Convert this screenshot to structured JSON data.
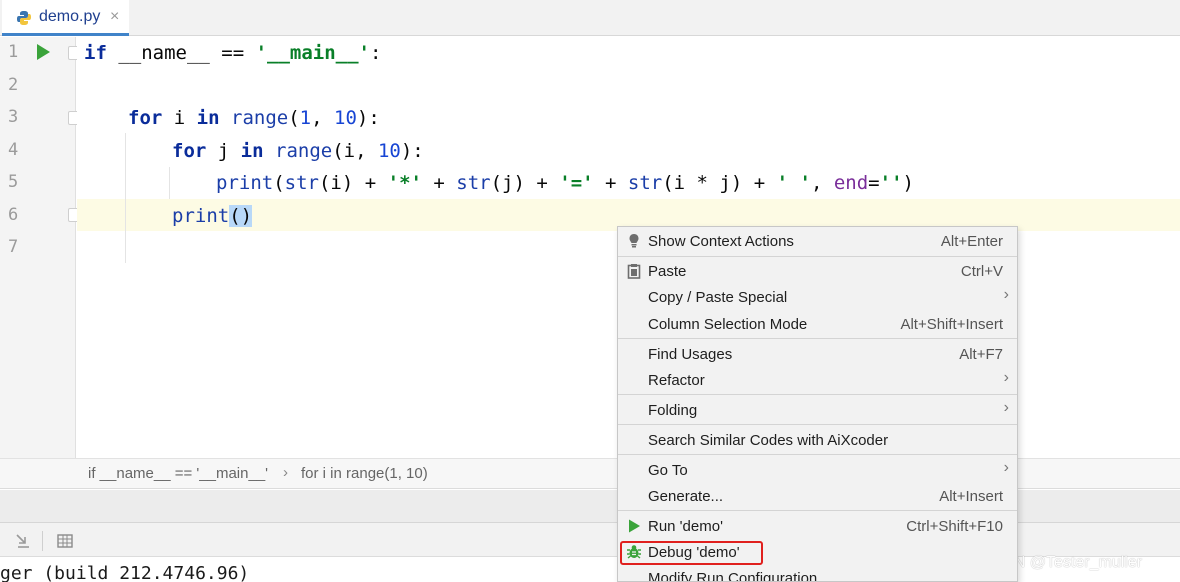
{
  "tab": {
    "filename": "demo.py",
    "close": "×"
  },
  "gutter": {
    "line_numbers": [
      "1",
      "2",
      "3",
      "4",
      "5",
      "6",
      "7"
    ]
  },
  "code": {
    "line1": {
      "kw": "if",
      "a": " __name__ == ",
      "s": "'__main__'",
      "b": ":"
    },
    "line3": {
      "kw1": "for",
      "a": " i ",
      "kw2": "in",
      "b": " ",
      "fn": "range",
      "c": "(",
      "n1": "1",
      "d": ", ",
      "n2": "10",
      "e": "):"
    },
    "line4": {
      "kw1": "for",
      "a": " j ",
      "kw2": "in",
      "b": " ",
      "fn": "range",
      "c": "(i, ",
      "n1": "10",
      "d": "):"
    },
    "line5": {
      "fn1": "print",
      "a": "(",
      "fn2": "str",
      "b": "(i) + ",
      "s1": "'*'",
      "c": " + ",
      "fn3": "str",
      "d": "(j) + ",
      "s2": "'='",
      "e": " + ",
      "fn4": "str",
      "f": "(i * j) + ",
      "s3": "' '",
      "g": ", ",
      "p": "end",
      "h": "=",
      "s4": "''",
      "i": ")"
    },
    "line6": {
      "fn": "print",
      "br": "()"
    }
  },
  "breadcrumb": {
    "item1": "if __name__ == '__main__'",
    "sep": "›",
    "item2": "for i in range(1, 10)"
  },
  "console": {
    "text": "ger (build 212.4746.96)"
  },
  "watermark": "CSDN @Tester_muller",
  "context_menu": {
    "show_context_actions": {
      "label": "Show Context Actions",
      "shortcut": "Alt+Enter"
    },
    "paste": {
      "label": "Paste",
      "shortcut": "Ctrl+V"
    },
    "copy_paste_special": {
      "label": "Copy / Paste Special"
    },
    "column_selection_mode": {
      "label": "Column Selection Mode",
      "shortcut": "Alt+Shift+Insert"
    },
    "find_usages": {
      "label": "Find Usages",
      "shortcut": "Alt+F7"
    },
    "refactor": {
      "label": "Refactor"
    },
    "folding": {
      "label": "Folding"
    },
    "search_similar": {
      "label": "Search Similar Codes with AiXcoder"
    },
    "go_to": {
      "label": "Go To"
    },
    "generate": {
      "label": "Generate...",
      "shortcut": "Alt+Insert"
    },
    "run": {
      "label": "Run 'demo'",
      "shortcut": "Ctrl+Shift+F10"
    },
    "debug": {
      "label": "Debug 'demo'"
    },
    "modify_run": {
      "label": "Modify Run Configuration..."
    },
    "submenu_arrow": "›"
  },
  "colors": {
    "accent": "#4083c9",
    "highlight_box": "#e0201e",
    "run_green": "#3aa33a"
  }
}
